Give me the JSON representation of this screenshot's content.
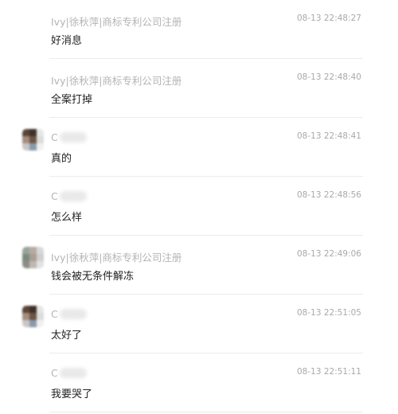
{
  "messages": [
    {
      "sender": "Ivy|徐秋萍|商标专利公司注册",
      "sender_blurred": false,
      "avatar_visible": false,
      "time": "08-13 22:48:27",
      "text": "好消息"
    },
    {
      "sender": "Ivy|徐秋萍|商标专利公司注册",
      "sender_blurred": false,
      "avatar_visible": false,
      "time": "08-13 22:48:40",
      "text": "全案打掉"
    },
    {
      "sender": "C",
      "sender_blurred": true,
      "avatar_visible": true,
      "avatar_colors": [
        "#5a4538",
        "#3f3028",
        "#e6e6e6",
        "#a48d80",
        "#6b5547",
        "#dcdcdc",
        "#c7c7c7",
        "#8a9aaa",
        "#f0f0f0"
      ],
      "time": "08-13 22:48:41",
      "text": "真的"
    },
    {
      "sender": "C",
      "sender_blurred": true,
      "avatar_visible": false,
      "time": "08-13 22:48:56",
      "text": "怎么样"
    },
    {
      "sender": "Ivy|徐秋萍|商标专利公司注册",
      "sender_blurred": false,
      "avatar_visible": true,
      "avatar_colors": [
        "#9aa39b",
        "#b7aa9f",
        "#d8d8d8",
        "#7c8a7e",
        "#a89f98",
        "#cfcfcf",
        "#8d8d86",
        "#c0b8b0",
        "#e2e2e2"
      ],
      "time": "08-13 22:49:06",
      "text": "钱会被无条件解冻"
    },
    {
      "sender": "C",
      "sender_blurred": true,
      "avatar_visible": true,
      "avatar_colors": [
        "#5a4538",
        "#3f3028",
        "#e6e6e6",
        "#a48d80",
        "#6b5547",
        "#dcdcdc",
        "#c7c7c7",
        "#8a9aaa",
        "#f0f0f0"
      ],
      "time": "08-13 22:51:05",
      "text": "太好了"
    },
    {
      "sender": "C",
      "sender_blurred": true,
      "avatar_visible": false,
      "time": "08-13 22:51:11",
      "text": "我要哭了"
    }
  ]
}
